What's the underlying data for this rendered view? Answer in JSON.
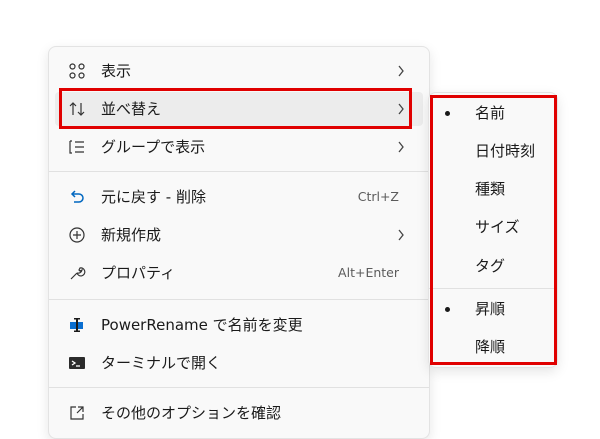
{
  "context_menu": {
    "items": [
      {
        "label": "表示",
        "icon": "view-grid-icon",
        "has_submenu": true
      },
      {
        "label": "並べ替え",
        "icon": "sort-icon",
        "has_submenu": true
      },
      {
        "label": "グループで表示",
        "icon": "group-by-icon",
        "has_submenu": true
      },
      {
        "label": "元に戻す - 削除",
        "icon": "undo-icon",
        "shortcut": "Ctrl+Z"
      },
      {
        "label": "新規作成",
        "icon": "new-icon",
        "has_submenu": true
      },
      {
        "label": "プロパティ",
        "icon": "wrench-icon",
        "shortcut": "Alt+Enter"
      },
      {
        "label": "PowerRename で名前を変更",
        "icon": "powerrename-icon"
      },
      {
        "label": "ターミナルで開く",
        "icon": "terminal-icon"
      },
      {
        "label": "その他のオプションを確認",
        "icon": "more-options-icon"
      }
    ]
  },
  "sort_submenu": {
    "items": [
      {
        "label": "名前",
        "selected": true
      },
      {
        "label": "日付時刻",
        "selected": false
      },
      {
        "label": "種類",
        "selected": false
      },
      {
        "label": "サイズ",
        "selected": false
      },
      {
        "label": "タグ",
        "selected": false
      },
      {
        "label": "昇順",
        "selected": true
      },
      {
        "label": "降順",
        "selected": false
      }
    ]
  },
  "colors": {
    "highlight_box": "#e00000",
    "accent_blue": "#0067c0",
    "menu_background": "#f9f9f9",
    "hover_background": "#ececec"
  }
}
